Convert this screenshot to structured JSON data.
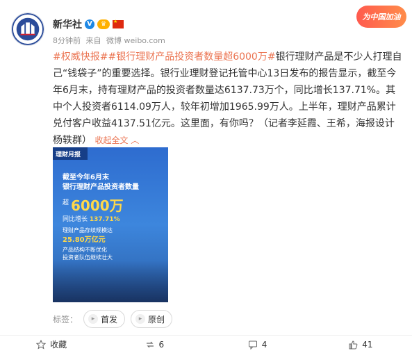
{
  "user": {
    "name": "新华社",
    "meta_time": "8分钟前",
    "meta_from": "来自",
    "meta_source": "微博 weibo.com"
  },
  "badge": {
    "text": "为中国加油"
  },
  "post": {
    "topic1": "#权威快报#",
    "topic2": "#银行理财产品投资者数量超6000万#",
    "body": "银行理财产品是不少人打理自己“钱袋子”的重要选择。银行业理财登记托管中心13日发布的报告显示，截至今年6月末，持有理财产品的投资者数量达6137.73万个，同比增长137.71%。其中个人投资者6114.09万人，较年初增加1965.99万人。上半年，理财产品累计兑付客户收益4137.51亿元。这里面，有你吗？（记者李延霞、王希，海报设计杨轶群）",
    "collapse": "收起全文"
  },
  "image": {
    "title": "理财月报",
    "line1": "截至今年6月末",
    "line2": "银行理财产品投资者数量",
    "prefix": "超",
    "big": "6000万",
    "growth_label": "同比增长",
    "growth_value": "137.71%",
    "scale_label": "理财产品存续规模达",
    "scale_value": "25.80万亿元",
    "line3": "产品结构不断优化",
    "line4": "投资者队伍继续壮大"
  },
  "tags": {
    "label": "标签：",
    "items": [
      "首发",
      "原创"
    ]
  },
  "actions": {
    "favorite": "收藏",
    "repost": "6",
    "comment": "4",
    "like": "41"
  },
  "colors": {
    "topic": "#eb7350",
    "brand_blue": "#1e88e5"
  }
}
